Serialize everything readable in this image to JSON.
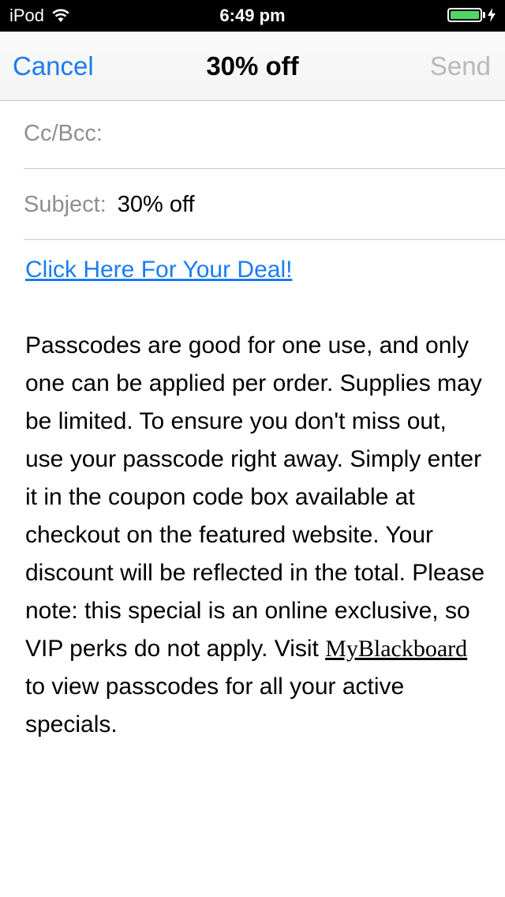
{
  "status_bar": {
    "device": "iPod",
    "time": "6:49 pm",
    "battery_level": 1.0,
    "battery_color": "#4cd964",
    "icons": [
      "wifi-icon",
      "battery-icon",
      "charging-bolt-icon"
    ]
  },
  "nav": {
    "cancel_label": "Cancel",
    "title": "30% off",
    "send_label": "Send",
    "accent_color": "#1a7cf0"
  },
  "fields": {
    "cc_label": "Cc/Bcc:",
    "cc_value": "",
    "subject_label": "Subject:",
    "subject_value": "30% off"
  },
  "body": {
    "deal_link": "Click Here For Your Deal!",
    "message_part1": "Passcodes are good for one use, and only one can be applied per order. Supplies may be limited. To ensure you don't miss out, use your passcode right away. Simply enter it in the coupon code box available at checkout on the featured website. Your discount will be reflected in the total. Please note: this special is an online exclusive, so VIP perks do not apply. Visit ",
    "myblackboard_link": "MyBlackboard",
    "message_part2": " to view passcodes for all your active specials."
  }
}
